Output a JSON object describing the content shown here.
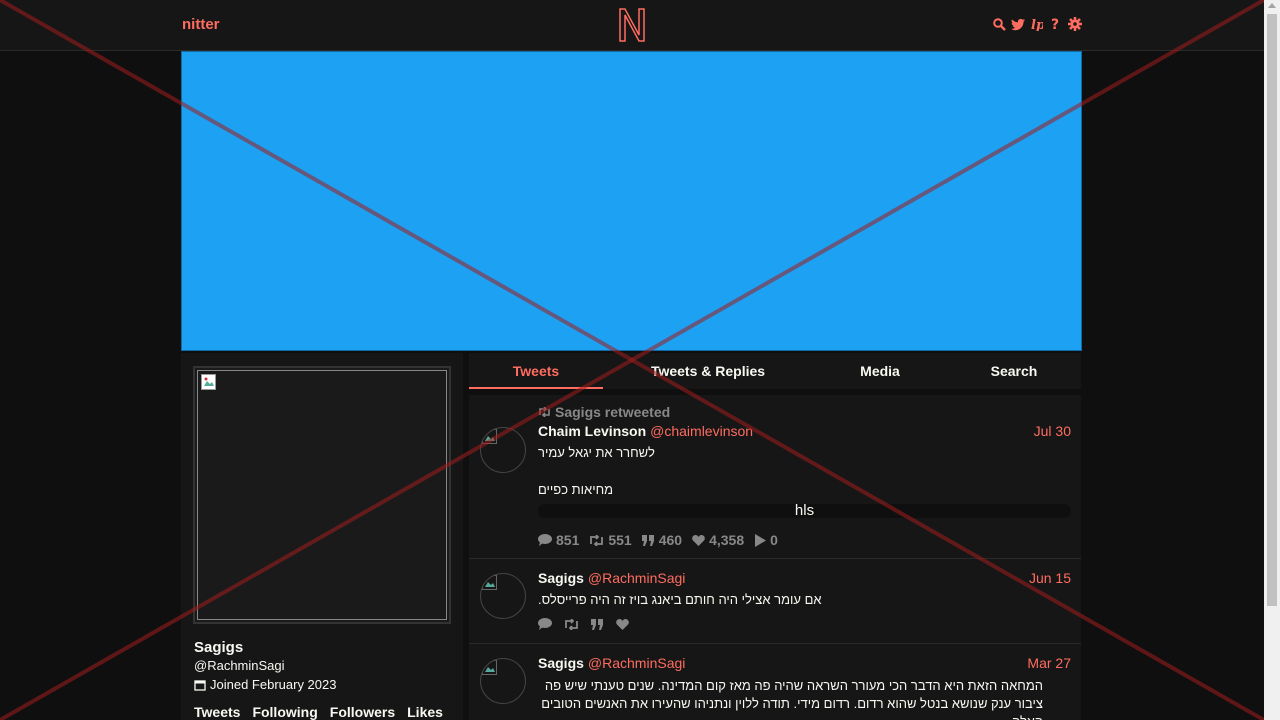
{
  "navbar": {
    "brand": "nitter"
  },
  "profile": {
    "fullname": "Sagigs",
    "username": "@RachminSagi",
    "joined": "Joined February 2023",
    "stats": [
      "Tweets",
      "Following",
      "Followers",
      "Likes"
    ]
  },
  "tabs": [
    "Tweets",
    "Tweets & Replies",
    "Media",
    "Search"
  ],
  "tweets": [
    {
      "retweet_header": "Sagigs retweeted",
      "name": "Chaim Levinson",
      "handle": "@chaimlevinson",
      "date": "Jul 30",
      "text_lines": [
        "לשחרר את יגאל עמיר",
        "מחיאות כפיים"
      ],
      "media_label": "hls",
      "stats": {
        "replies": "851",
        "retweets": "551",
        "quotes": "460",
        "likes": "4,358",
        "plays": "0"
      }
    },
    {
      "name": "Sagigs",
      "handle": "@RachminSagi",
      "date": "Jun 15",
      "text": "אם עומר אצילי היה חותם ביאנג בויז זה היה פרייסלס."
    },
    {
      "name": "Sagigs",
      "handle": "@RachminSagi",
      "date": "Mar 27",
      "text": "המחאה הזאת היא הדבר הכי מעורר השראה שהיה פה מאז קום המדינה. שנים טענתי שיש פה ציבור ענק שנושא בנטל שהוא רדום. רדום מידי. תודה ללוין ונתניהו שהעירו את האנשים הטובים האלה."
    }
  ],
  "colors": {
    "accent": "#ff6c60",
    "banner": "#1da1f2",
    "background": "#0f0f0f",
    "panel": "#161616"
  }
}
